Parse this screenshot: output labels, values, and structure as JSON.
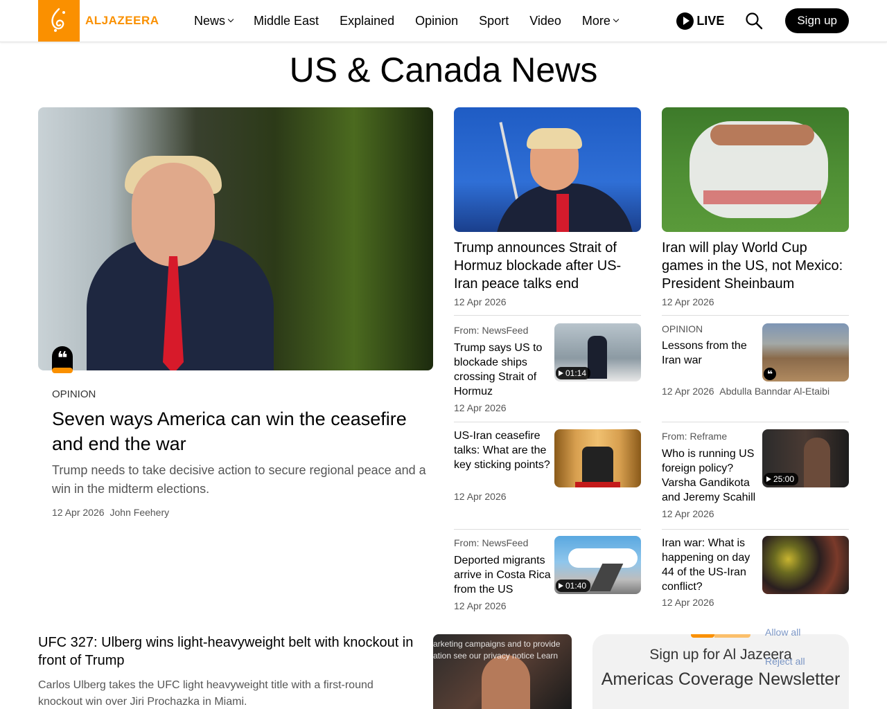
{
  "header": {
    "logo_text": "ALJAZEERA",
    "nav": [
      "News",
      "Middle East",
      "Explained",
      "Opinion",
      "Sport",
      "Video",
      "More"
    ],
    "live_label": "LIVE",
    "signup_label": "Sign up"
  },
  "page_title": "US & Canada News",
  "lead": {
    "kicker": "OPINION",
    "title": "Seven ways America can win the ceasefire and end the war",
    "desc": "Trump needs to take decisive action to secure regional peace and a win in the midterm elections.",
    "date": "12 Apr 2026",
    "author": "John Feehery"
  },
  "top": [
    {
      "title": "Trump announces Strait of Hormuz blockade after US-Iran peace talks end",
      "date": "12 Apr 2026"
    },
    {
      "title": "Iran will play World Cup games in the US, not Mexico: President Sheinbaum",
      "date": "12 Apr 2026"
    }
  ],
  "small": [
    {
      "kicker": "From: NewsFeed",
      "title": "Trump says US to blockade ships crossing Strait of Hormuz",
      "date": "12 Apr 2026",
      "duration": "01:14"
    },
    {
      "kicker": "OPINION",
      "title": "Lessons from the Iran war",
      "date": "12 Apr 2026",
      "author": "Abdulla Banndar Al-Etaibi"
    },
    {
      "kicker": "",
      "title": "US-Iran ceasefire talks: What are the key sticking points?",
      "date": "12 Apr 2026"
    },
    {
      "kicker": "From: Reframe",
      "title": "Who is running US foreign policy? Varsha Gandikota and Jeremy Scahill",
      "date": "12 Apr 2026",
      "duration": "25:00"
    },
    {
      "kicker": "From: NewsFeed",
      "title": "Deported migrants arrive in Costa Rica from the US",
      "date": "12 Apr 2026",
      "duration": "01:40"
    },
    {
      "kicker": "",
      "title": "Iran war: What is happening on day 44 of the US-Iran conflict?",
      "date": "12 Apr 2026"
    }
  ],
  "bottom": {
    "title": "UFC 327: Ulberg wins light-heavyweight belt with knockout in front of Trump",
    "desc": "Carlos Ulberg takes the UFC light heavyweight title with a first-round knockout win over Jiri Prochazka in Miami.",
    "overlay_line1": "arketing campaigns and to provide",
    "overlay_line2": "ation see our privacy notice Learn"
  },
  "newsletter": {
    "line1": "Sign up for Al Jazeera",
    "line2": "Americas Coverage Newsletter"
  },
  "cookie": {
    "allow": "Allow all",
    "reject": "Reject all"
  },
  "colors": {
    "brand": "#fa9000",
    "text": "#000000",
    "muted": "#555555"
  }
}
